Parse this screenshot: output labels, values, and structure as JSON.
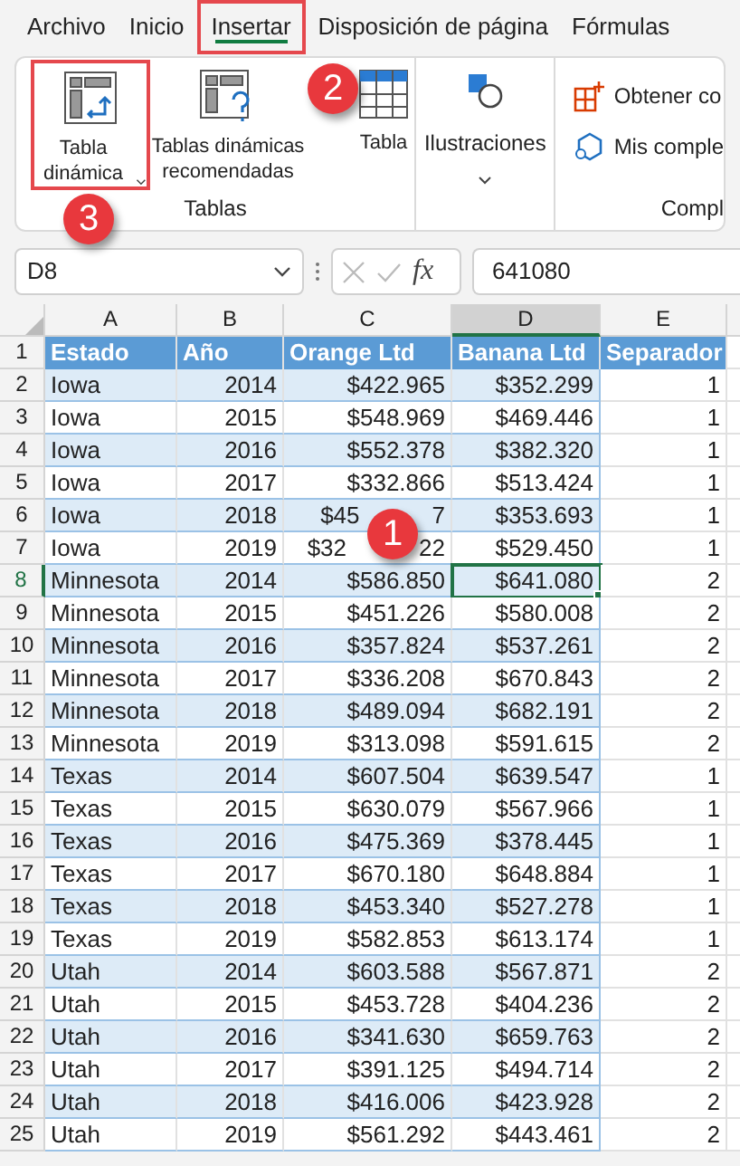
{
  "menu_tabs": [
    {
      "label": "Archivo",
      "selected": false
    },
    {
      "label": "Inicio",
      "selected": false
    },
    {
      "label": "Insertar",
      "selected": true
    },
    {
      "label": "Disposición de página",
      "selected": false
    },
    {
      "label": "Fórmulas",
      "selected": false
    }
  ],
  "ribbon": {
    "groups": [
      {
        "label": "Tablas",
        "buttons": [
          {
            "kind": "pivot",
            "label": "Tabla dinámica",
            "caret": true
          },
          {
            "kind": "recommended",
            "label": "Tablas dinámicas recomendadas",
            "caret": false
          },
          {
            "kind": "table",
            "label": "Tabla",
            "caret": false
          }
        ]
      },
      {
        "buttons": [
          {
            "kind": "shapes",
            "label": "Ilustraciones",
            "caret": true
          }
        ]
      },
      {
        "label": "Compl",
        "buttons": [
          {
            "kind": "get",
            "label": "Obtener co",
            "caret": false
          },
          {
            "kind": "addins",
            "label": "Mis comple",
            "caret": false
          }
        ]
      }
    ]
  },
  "formula_bar": {
    "name_box": "D8",
    "fx_label": "fx",
    "value": "641080"
  },
  "columns": [
    {
      "label": "A",
      "selected": false
    },
    {
      "label": "B",
      "selected": false
    },
    {
      "label": "C",
      "selected": false
    },
    {
      "label": "D",
      "selected": true
    },
    {
      "label": "E",
      "selected": false
    }
  ],
  "rows": [
    {
      "number": "1",
      "selected": false,
      "cells": [
        "Estado",
        "Año",
        "Orange Ltd",
        "Banana Ltd",
        "Separador"
      ]
    },
    {
      "number": "2",
      "selected": false,
      "cells": [
        "Iowa",
        "2014",
        "$422.965",
        "$352.299",
        "1"
      ]
    },
    {
      "number": "3",
      "selected": false,
      "cells": [
        "Iowa",
        "2015",
        "$548.969",
        "$469.446",
        "1"
      ]
    },
    {
      "number": "4",
      "selected": false,
      "cells": [
        "Iowa",
        "2016",
        "$552.378",
        "$382.320",
        "1"
      ]
    },
    {
      "number": "5",
      "selected": false,
      "cells": [
        "Iowa",
        "2017",
        "$332.866",
        "$513.424",
        "1"
      ]
    },
    {
      "number": "6",
      "selected": false,
      "cells": [
        "Iowa",
        "2018",
        [
          "$45",
          "7"
        ],
        "$353.693",
        "1"
      ]
    },
    {
      "number": "7",
      "selected": false,
      "cells": [
        "Iowa",
        "2019",
        [
          "$32",
          "22"
        ],
        "$529.450",
        "1"
      ]
    },
    {
      "number": "8",
      "selected": true,
      "cells": [
        "Minnesota",
        "2014",
        "$586.850",
        "$641.080",
        "2"
      ]
    },
    {
      "number": "9",
      "selected": false,
      "cells": [
        "Minnesota",
        "2015",
        "$451.226",
        "$580.008",
        "2"
      ]
    },
    {
      "number": "10",
      "selected": false,
      "cells": [
        "Minnesota",
        "2016",
        "$357.824",
        "$537.261",
        "2"
      ]
    },
    {
      "number": "11",
      "selected": false,
      "cells": [
        "Minnesota",
        "2017",
        "$336.208",
        "$670.843",
        "2"
      ]
    },
    {
      "number": "12",
      "selected": false,
      "cells": [
        "Minnesota",
        "2018",
        "$489.094",
        "$682.191",
        "2"
      ]
    },
    {
      "number": "13",
      "selected": false,
      "cells": [
        "Minnesota",
        "2019",
        "$313.098",
        "$591.615",
        "2"
      ]
    },
    {
      "number": "14",
      "selected": false,
      "cells": [
        "Texas",
        "2014",
        "$607.504",
        "$639.547",
        "1"
      ]
    },
    {
      "number": "15",
      "selected": false,
      "cells": [
        "Texas",
        "2015",
        "$630.079",
        "$567.966",
        "1"
      ]
    },
    {
      "number": "16",
      "selected": false,
      "cells": [
        "Texas",
        "2016",
        "$475.369",
        "$378.445",
        "1"
      ]
    },
    {
      "number": "17",
      "selected": false,
      "cells": [
        "Texas",
        "2017",
        "$670.180",
        "$648.884",
        "1"
      ]
    },
    {
      "number": "18",
      "selected": false,
      "cells": [
        "Texas",
        "2018",
        "$453.340",
        "$527.278",
        "1"
      ]
    },
    {
      "number": "19",
      "selected": false,
      "cells": [
        "Texas",
        "2019",
        "$582.853",
        "$613.174",
        "1"
      ]
    },
    {
      "number": "20",
      "selected": false,
      "cells": [
        "Utah",
        "2014",
        "$603.588",
        "$567.871",
        "2"
      ]
    },
    {
      "number": "21",
      "selected": false,
      "cells": [
        "Utah",
        "2015",
        "$453.728",
        "$404.236",
        "2"
      ]
    },
    {
      "number": "22",
      "selected": false,
      "cells": [
        "Utah",
        "2016",
        "$341.630",
        "$659.763",
        "2"
      ]
    },
    {
      "number": "23",
      "selected": false,
      "cells": [
        "Utah",
        "2017",
        "$391.125",
        "$494.714",
        "2"
      ]
    },
    {
      "number": "24",
      "selected": false,
      "cells": [
        "Utah",
        "2018",
        "$416.006",
        "$423.928",
        "2"
      ]
    },
    {
      "number": "25",
      "selected": false,
      "cells": [
        "Utah",
        "2019",
        "$561.292",
        "$443.461",
        "2"
      ]
    }
  ],
  "callouts": [
    {
      "label": "1",
      "kind": "grid"
    },
    {
      "label": "2",
      "kind": "tab"
    },
    {
      "label": "3",
      "kind": "button"
    }
  ]
}
